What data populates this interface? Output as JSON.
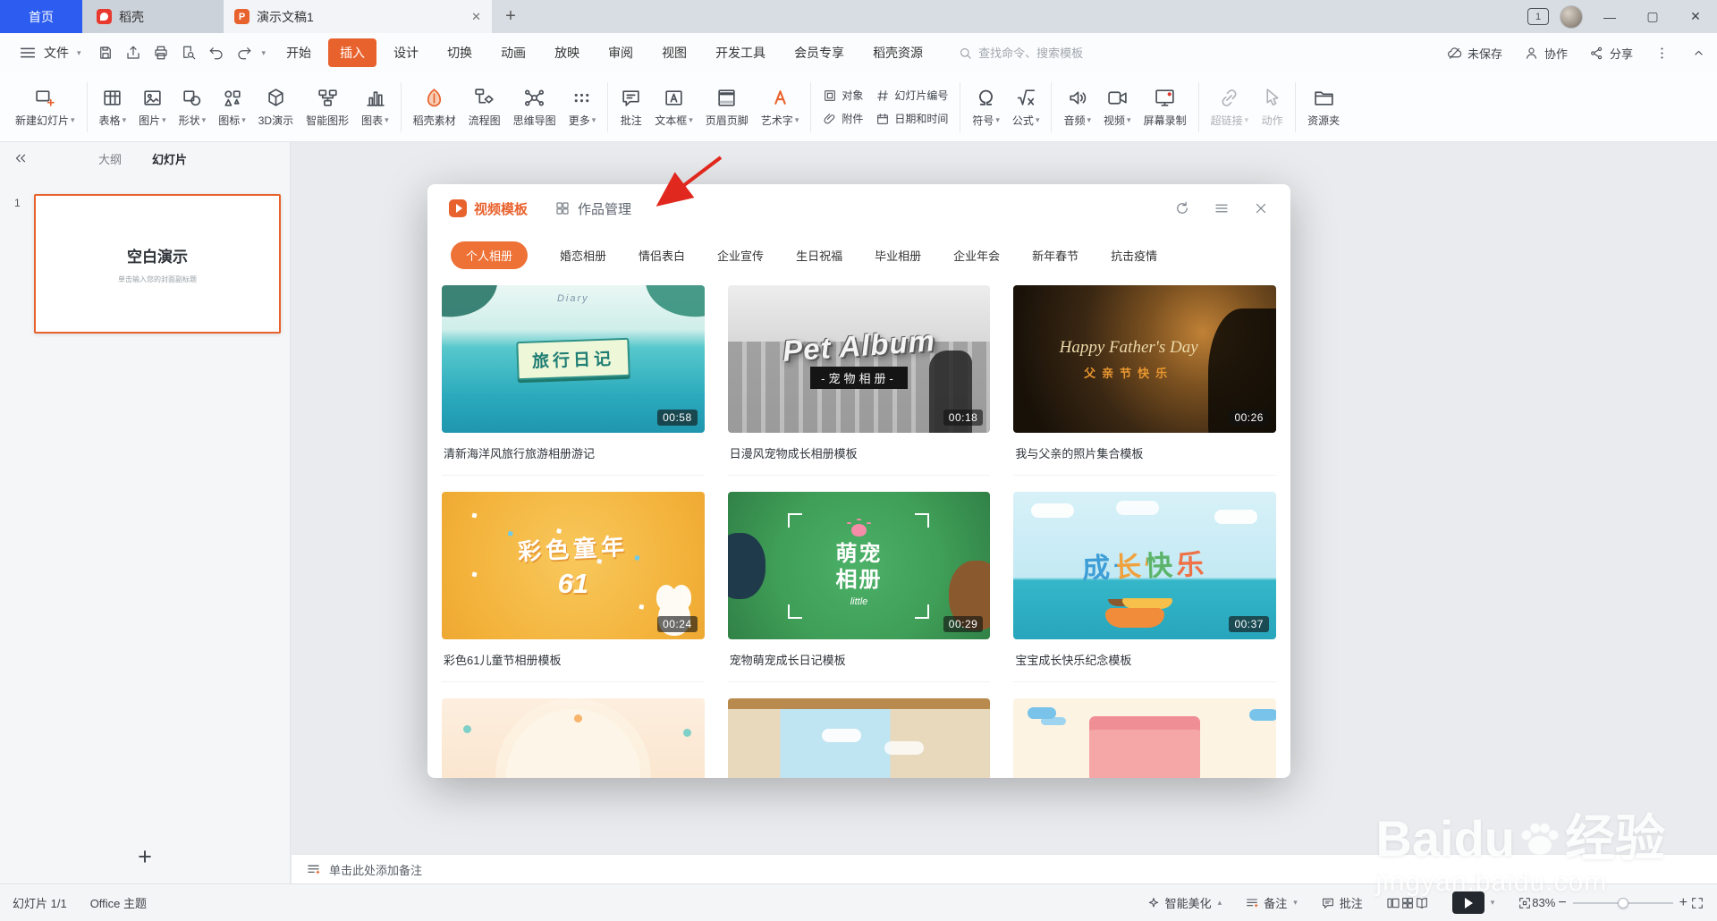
{
  "colors": {
    "accent": "#e8622d",
    "pill": "#ee7135",
    "home_blue": "#2c5df0",
    "arrow": "#e0281e"
  },
  "window": {
    "home_tab": "首页",
    "docer_tab": "稻壳",
    "doc_tab": "演示文稿1",
    "pane_badge": "1"
  },
  "menubar": {
    "file_label": "文件",
    "items": [
      "开始",
      "插入",
      "设计",
      "切换",
      "动画",
      "放映",
      "审阅",
      "视图",
      "开发工具",
      "会员专享",
      "稻壳资源"
    ],
    "active_item": "插入",
    "search_placeholder": "查找命令、搜索模板",
    "unsaved_label": "未保存",
    "collab_label": "协作",
    "share_label": "分享"
  },
  "ribbon": {
    "items": [
      {
        "type": "big",
        "label": "新建幻灯片",
        "icon": "newslide",
        "caret": true
      },
      {
        "type": "div"
      },
      {
        "type": "big",
        "label": "表格",
        "icon": "table",
        "caret": true
      },
      {
        "type": "big",
        "label": "图片",
        "icon": "picture",
        "caret": true
      },
      {
        "type": "big",
        "label": "形状",
        "icon": "shape",
        "caret": true
      },
      {
        "type": "big",
        "label": "图标",
        "icon": "iconlib",
        "caret": true
      },
      {
        "type": "big",
        "label": "3D演示",
        "icon": "cube"
      },
      {
        "type": "big",
        "label": "智能图形",
        "icon": "smartart"
      },
      {
        "type": "big",
        "label": "图表",
        "icon": "chart",
        "caret": true
      },
      {
        "type": "div"
      },
      {
        "type": "big",
        "label": "稻壳素材",
        "icon": "docer"
      },
      {
        "type": "big",
        "label": "流程图",
        "icon": "flowchart"
      },
      {
        "type": "big",
        "label": "思维导图",
        "icon": "mindmap"
      },
      {
        "type": "big",
        "label": "更多",
        "icon": "more",
        "caret": true
      },
      {
        "type": "div"
      },
      {
        "type": "big",
        "label": "批注",
        "icon": "comment"
      },
      {
        "type": "big",
        "label": "文本框",
        "icon": "textbox",
        "caret": true
      },
      {
        "type": "big",
        "label": "页眉页脚",
        "icon": "headerfooter"
      },
      {
        "type": "big",
        "label": "艺术字",
        "icon": "wordart",
        "caret": true
      },
      {
        "type": "div"
      },
      {
        "type": "stack",
        "items": [
          {
            "label": "对象",
            "icon": "object"
          },
          {
            "label": "附件",
            "icon": "attach"
          }
        ]
      },
      {
        "type": "stack",
        "items": [
          {
            "label": "幻灯片编号",
            "icon": "slidenum"
          },
          {
            "label": "日期和时间",
            "icon": "datetime"
          }
        ]
      },
      {
        "type": "div"
      },
      {
        "type": "big",
        "label": "符号",
        "icon": "symbol",
        "caret": true
      },
      {
        "type": "big",
        "label": "公式",
        "icon": "formula",
        "caret": true
      },
      {
        "type": "div"
      },
      {
        "type": "big",
        "label": "音频",
        "icon": "audio",
        "caret": true
      },
      {
        "type": "big",
        "label": "视频",
        "icon": "video",
        "caret": true
      },
      {
        "type": "big",
        "label": "屏幕录制",
        "icon": "screenrec"
      },
      {
        "type": "div"
      },
      {
        "type": "big",
        "label": "超链接",
        "icon": "hyperlink",
        "caret": true,
        "disabled": true
      },
      {
        "type": "big",
        "label": "动作",
        "icon": "action",
        "disabled": true
      },
      {
        "type": "div"
      },
      {
        "type": "big",
        "label": "资源夹",
        "icon": "folder"
      }
    ]
  },
  "left_panel": {
    "tabs": [
      "大纲",
      "幻灯片"
    ],
    "active_tab": "幻灯片",
    "slide_number": "1",
    "slide_title": "空白演示",
    "slide_subtitle": "单击输入您的封面副标题"
  },
  "notes": {
    "placeholder": "单击此处添加备注"
  },
  "statusbar": {
    "slide_info": "幻灯片 1/1",
    "theme": "Office 主题",
    "beautify": "智能美化",
    "notes_btn": "备注",
    "comment_btn": "批注",
    "zoom": "83%"
  },
  "dialog": {
    "tab_video": "视频模板",
    "tab_works": "作品管理",
    "categories": [
      "个人相册",
      "婚恋相册",
      "情侣表白",
      "企业宣传",
      "生日祝福",
      "毕业相册",
      "企业年会",
      "新年春节",
      "抗击疫情"
    ],
    "active_category": "个人相册",
    "cards": [
      {
        "title": "清新海洋风旅行旅游相册游记",
        "duration": "00:58",
        "theme": "ocean",
        "art_text": "旅行日记",
        "art_sub": "Diary"
      },
      {
        "title": "日漫风宠物成长相册模板",
        "duration": "00:18",
        "theme": "pet",
        "art_text": "Pet Album",
        "art_sub": "-宠物相册-"
      },
      {
        "title": "我与父亲的照片集合模板",
        "duration": "00:26",
        "theme": "father",
        "art_text": "Happy Father's Day",
        "art_sub": "父亲节快乐"
      },
      {
        "title": "彩色61儿童节相册模板",
        "duration": "00:24",
        "theme": "children",
        "art_text": "彩色童年",
        "art_sub": "61"
      },
      {
        "title": "宠物萌宠成长日记模板",
        "duration": "00:29",
        "theme": "pets-green",
        "art_text": "萌宠相册",
        "art_sub": "little"
      },
      {
        "title": "宝宝成长快乐纪念模板",
        "duration": "00:37",
        "theme": "growth",
        "art_text": "成长快乐",
        "art_sub": ""
      }
    ],
    "partial_cards": [
      {
        "theme": "peach"
      },
      {
        "theme": "room"
      },
      {
        "theme": "envelope"
      }
    ]
  },
  "watermark": {
    "brand": "Baidu",
    "brand_cn": "经验",
    "url": "jingyan.baidu.com"
  }
}
